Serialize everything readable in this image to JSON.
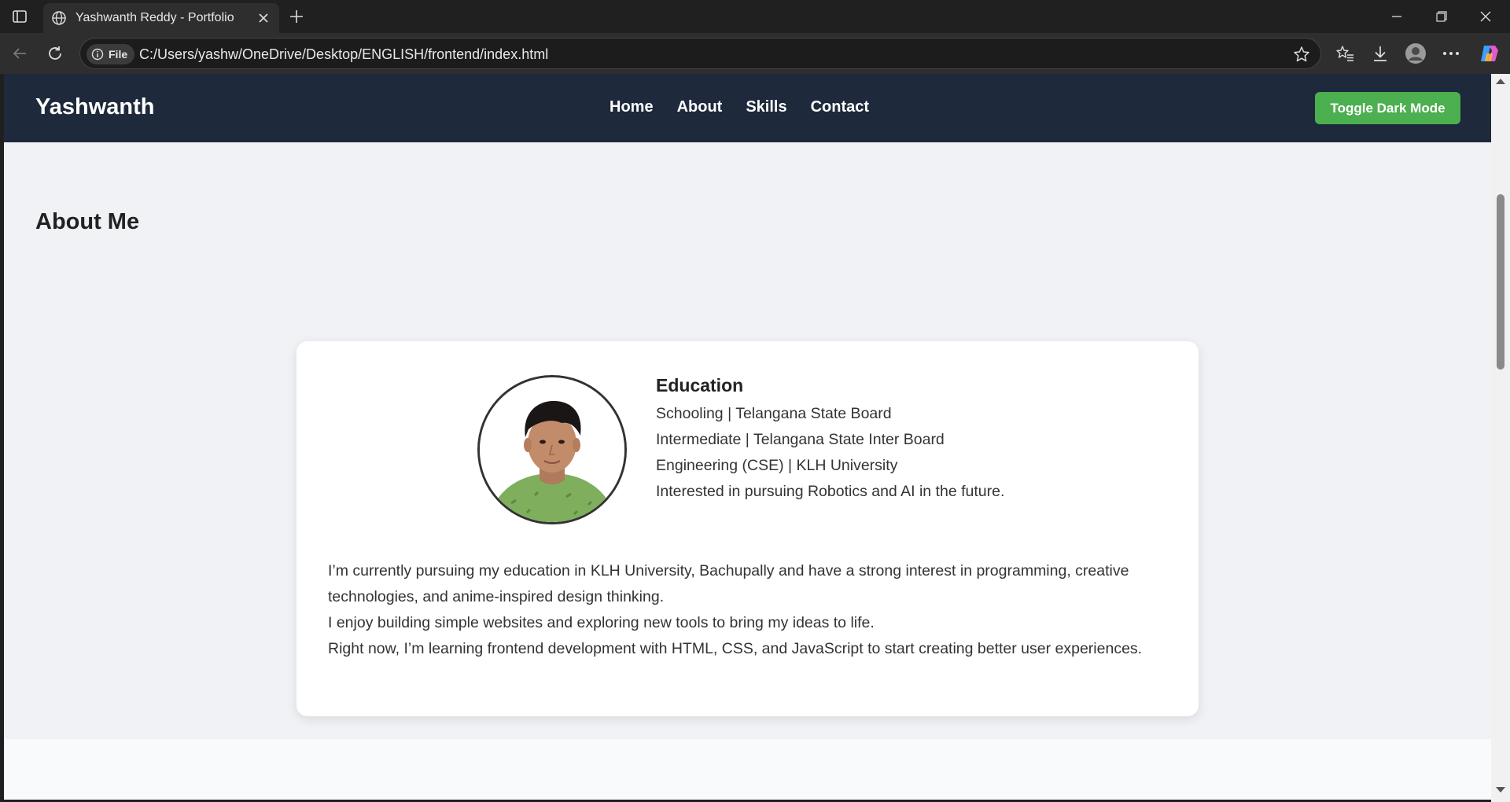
{
  "browser": {
    "tab_title": "Yashwanth Reddy - Portfolio",
    "address_label": "File",
    "url": "C:/Users/yashw/OneDrive/Desktop/ENGLISH/frontend/index.html"
  },
  "nav": {
    "brand": "Yashwanth",
    "links": [
      "Home",
      "About",
      "Skills",
      "Contact"
    ],
    "toggle_label": "Toggle Dark Mode"
  },
  "about": {
    "title": "About Me",
    "education": {
      "heading": "Education",
      "lines": [
        "Schooling | Telangana State Board",
        "Intermediate | Telangana State Inter Board",
        "Engineering (CSE) | KLH University",
        "Interested in pursuing Robotics and AI in the future."
      ]
    },
    "paragraphs": [
      "I’m currently pursuing my education in KLH University, Bachupally and have a strong interest in programming, creative technologies, and anime-inspired design thinking.",
      "I enjoy building simple websites and exploring new tools to bring my ideas to life.",
      "Right now, I’m learning frontend development with HTML, CSS, and JavaScript to start creating better user experiences."
    ]
  },
  "colors": {
    "nav_bg": "#1e293b",
    "toggle_bg": "#4caf50",
    "section_bg": "#f0f2f5"
  }
}
